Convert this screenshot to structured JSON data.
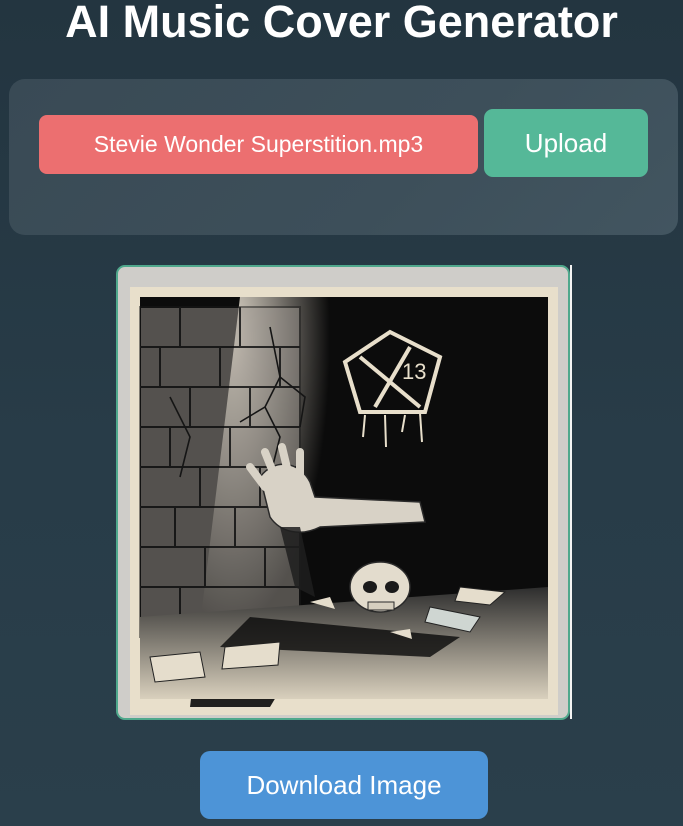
{
  "header": {
    "title": "AI Music Cover Generator"
  },
  "upload": {
    "file_name": "Stevie Wonder Superstition.mp3",
    "upload_label": "Upload"
  },
  "cover": {
    "badge_number": "13"
  },
  "actions": {
    "download_label": "Download Image"
  },
  "colors": {
    "background": "#283c48",
    "panel": "#3d4f5a",
    "file_field": "#ec6f70",
    "upload_button": "#55b898",
    "download_button": "#4d94d7",
    "cover_border": "#4fa88c"
  }
}
